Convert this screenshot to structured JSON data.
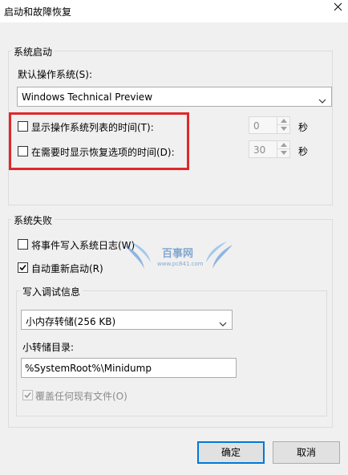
{
  "window": {
    "title": "启动和故障恢复"
  },
  "system_startup": {
    "group_title": "系统启动",
    "default_os_label": "默认操作系统(S):",
    "default_os_value": "Windows Technical Preview",
    "show_os_list_label": "显示操作系统列表的时间(T):",
    "show_os_list_checked": false,
    "show_os_list_value": "0",
    "show_recovery_label": "在需要时显示恢复选项的时间(D):",
    "show_recovery_checked": false,
    "show_recovery_value": "30",
    "seconds_unit": "秒"
  },
  "system_failure": {
    "group_title": "系统失败",
    "write_event_label": "将事件写入系统日志(W)",
    "write_event_checked": false,
    "auto_restart_label": "自动重新启动(R)",
    "auto_restart_checked": true,
    "debug_group_title": "写入调试信息",
    "debug_type_value": "小内存转储(256 KB)",
    "dump_dir_label": "小转储目录:",
    "dump_dir_value": "%SystemRoot%\\Minidump",
    "overwrite_label": "覆盖任何现有文件(O)",
    "overwrite_checked": true,
    "overwrite_disabled": true
  },
  "buttons": {
    "ok_label": "确定",
    "cancel_label": "取消"
  },
  "watermark": {
    "text": "百事网",
    "sub": "www.pc841.com"
  },
  "colors": {
    "highlight": "#e0282a",
    "accent": "#0078d7"
  }
}
